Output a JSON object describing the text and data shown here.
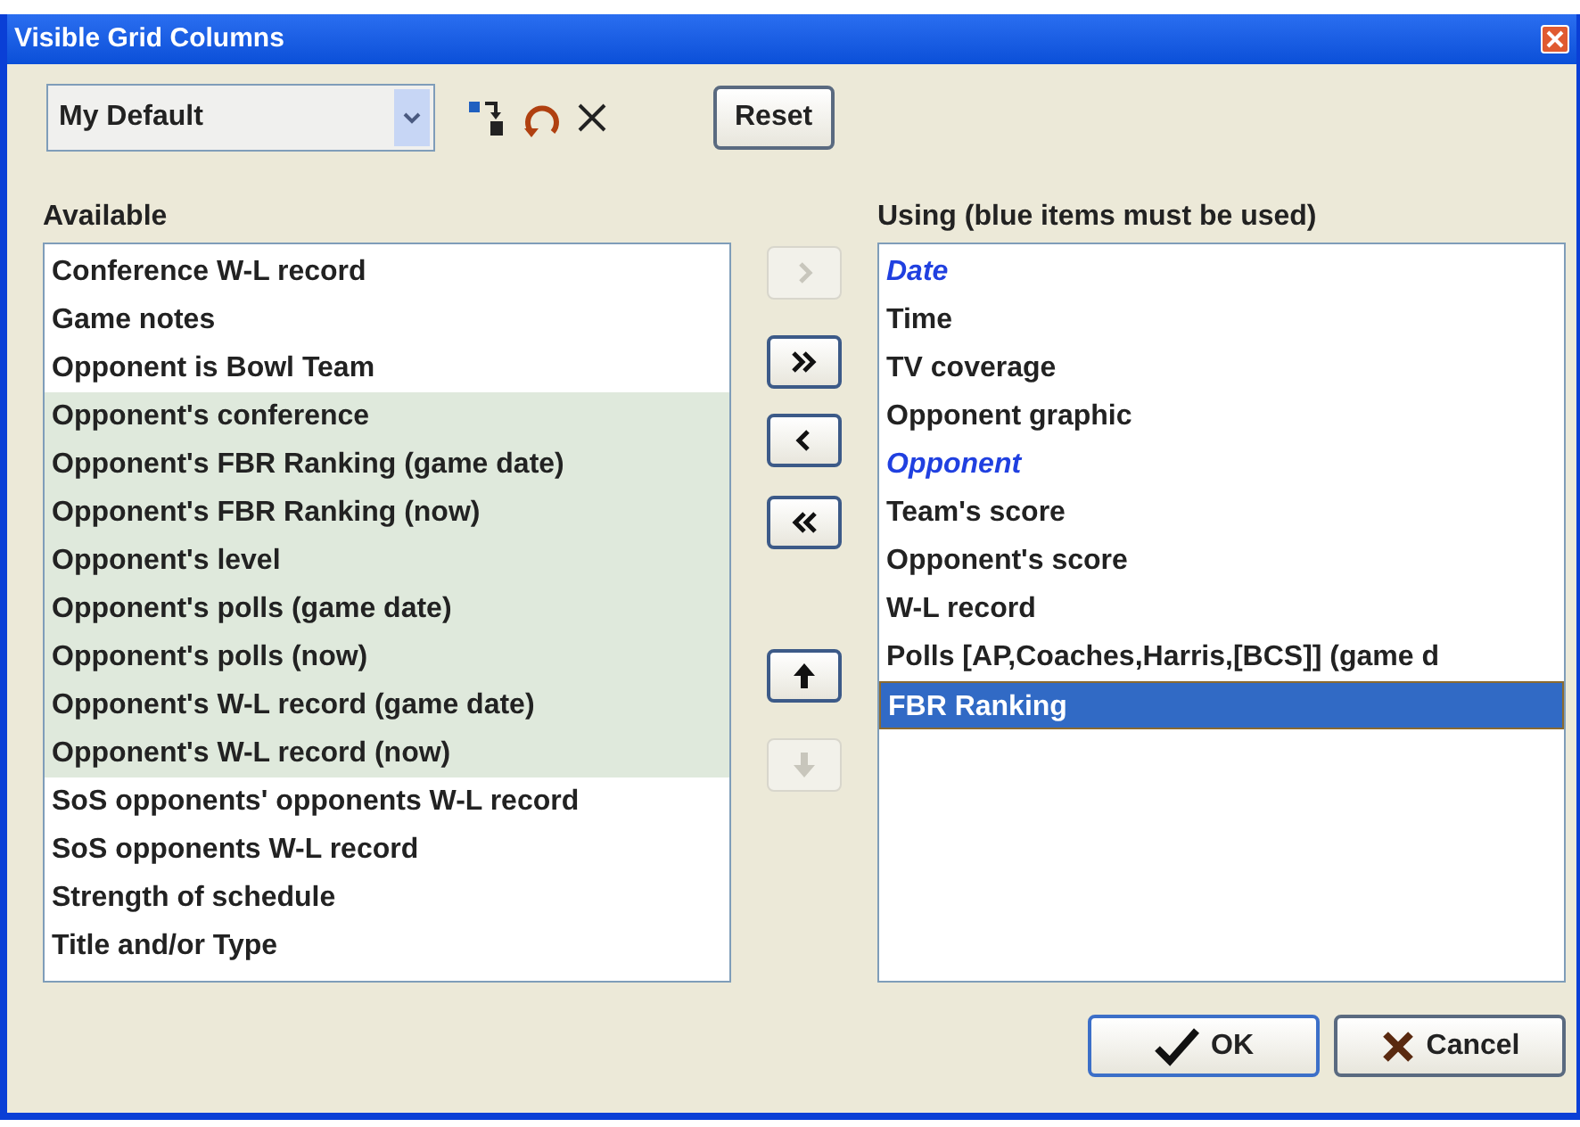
{
  "window": {
    "title": "Visible Grid Columns"
  },
  "profile": {
    "value": "My Default"
  },
  "reset_button": "Reset",
  "available": {
    "label": "Available",
    "items": [
      {
        "label": "Conference W-L record",
        "highlighted": false
      },
      {
        "label": "Game notes",
        "highlighted": false
      },
      {
        "label": "Opponent is Bowl Team",
        "highlighted": false
      },
      {
        "label": "Opponent's conference",
        "highlighted": true
      },
      {
        "label": "Opponent's FBR Ranking (game date)",
        "highlighted": true
      },
      {
        "label": "Opponent's FBR Ranking (now)",
        "highlighted": true
      },
      {
        "label": "Opponent's level",
        "highlighted": true
      },
      {
        "label": "Opponent's polls (game date)",
        "highlighted": true
      },
      {
        "label": "Opponent's polls (now)",
        "highlighted": true
      },
      {
        "label": "Opponent's W-L record (game date)",
        "highlighted": true
      },
      {
        "label": "Opponent's W-L record (now)",
        "highlighted": true
      },
      {
        "label": "SoS opponents' opponents W-L record",
        "highlighted": false
      },
      {
        "label": "SoS opponents W-L record",
        "highlighted": false
      },
      {
        "label": "Strength of schedule",
        "highlighted": false
      },
      {
        "label": "Title and/or Type",
        "highlighted": false
      }
    ]
  },
  "move_buttons": [
    {
      "kind": "add",
      "disabled": true
    },
    {
      "kind": "add-all",
      "disabled": false
    },
    {
      "kind": "remove",
      "disabled": false
    },
    {
      "kind": "remove-all",
      "disabled": false
    },
    {
      "kind": "up",
      "disabled": false
    },
    {
      "kind": "down",
      "disabled": true
    }
  ],
  "using": {
    "label": "Using (blue items must be used)",
    "items": [
      {
        "label": "Date",
        "required": true,
        "selected": false
      },
      {
        "label": "Time",
        "required": false,
        "selected": false
      },
      {
        "label": "TV coverage",
        "required": false,
        "selected": false
      },
      {
        "label": "Opponent graphic",
        "required": false,
        "selected": false
      },
      {
        "label": "Opponent",
        "required": true,
        "selected": false
      },
      {
        "label": "Team's score",
        "required": false,
        "selected": false
      },
      {
        "label": "Opponent's score",
        "required": false,
        "selected": false
      },
      {
        "label": "W-L record",
        "required": false,
        "selected": false
      },
      {
        "label": "Polls [AP,Coaches,Harris,[BCS]] (game d",
        "required": false,
        "selected": false
      },
      {
        "label": "FBR Ranking",
        "required": false,
        "selected": true
      }
    ]
  },
  "ok_button": "OK",
  "cancel_button": "Cancel"
}
